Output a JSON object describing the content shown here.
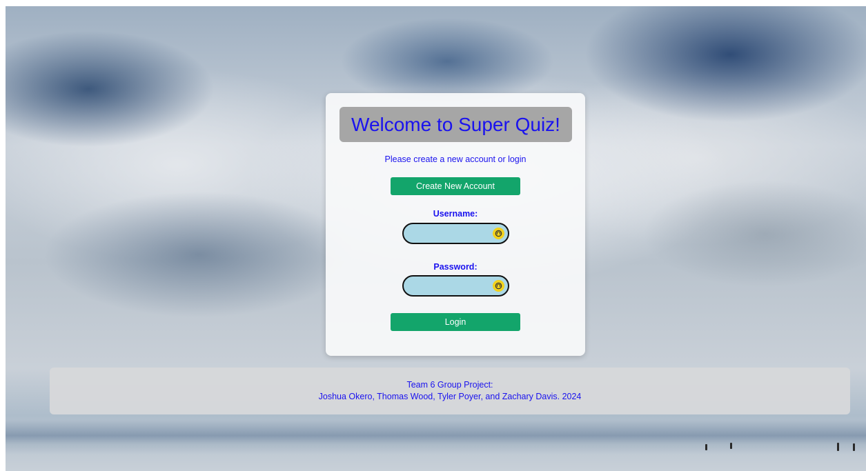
{
  "page": {
    "title": "Welcome to Super Quiz!",
    "subtitle": "Please create a new account or login"
  },
  "buttons": {
    "create_account_label": "Create New Account",
    "login_label": "Login"
  },
  "form": {
    "username_label": "Username:",
    "username_value": "",
    "password_label": "Password:",
    "password_value": "",
    "autofill_icon": "password-key-icon"
  },
  "footer": {
    "line1": "Team 6 Group Project:",
    "line2": "Joshua Okero, Thomas Wood, Tyler Poyer, and Zachary Davis. 2024"
  },
  "colors": {
    "heading_text": "#1a12ee",
    "button_bg": "#13a56b",
    "input_bg": "#abd8e6",
    "title_box_bg": "#a6a6a6",
    "autofill_icon_bg": "#f2d21c"
  }
}
